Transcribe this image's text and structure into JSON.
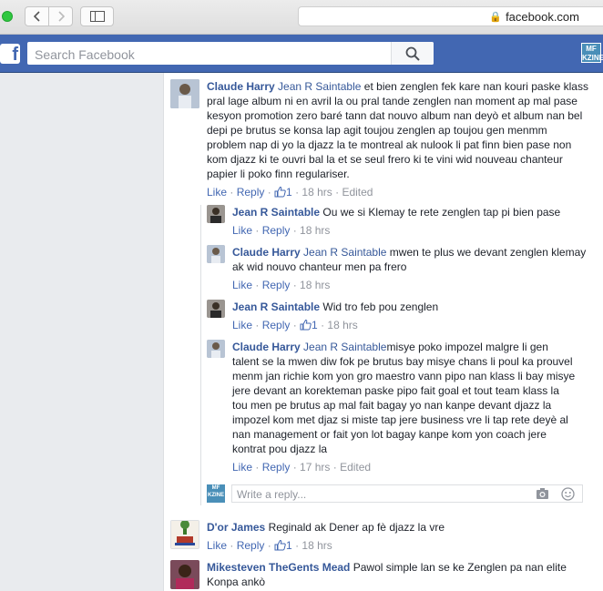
{
  "browser": {
    "url": "facebook.com",
    "icons": {
      "back": "chevron-left-icon",
      "forward": "chevron-right-icon",
      "sidebar": "sidebar-icon",
      "lock": "lock-icon"
    }
  },
  "header": {
    "logo": "f",
    "search_placeholder": "Search Facebook",
    "page_badge": "MF\nKZINE",
    "accent_color": "#4267b2"
  },
  "comments": [
    {
      "author": "Claude Harry",
      "tag": "Jean R Saintable",
      "text": "et bien zenglen fek kare nan kouri paske klass pral lage album ni en avril la ou pral tande zenglen nan moment ap mal pase kesyon promotion zero baré tann dat nouvo album nan deyò et album nan bel depi pe brutus se konsa lap agit toujou zenglen ap toujou gen menmm problem nap di yo la djazz la te montreal ak nulook li pat finn bien pase non kom djazz ki te ouvri bal la et se seul frero ki te vini wid nouveau chanteur papier li poko finn regulariser.",
      "like": "Like",
      "reply": "Reply",
      "likes": "1",
      "time": "18 hrs",
      "edited": "Edited"
    }
  ],
  "replies": [
    {
      "author": "Jean R Saintable",
      "tag": "",
      "text": "Ou we si Klemay te rete zenglen tap pi bien pase",
      "like": "Like",
      "reply": "Reply",
      "likes": "",
      "time": "18 hrs",
      "edited": ""
    },
    {
      "author": "Claude Harry",
      "tag": "Jean R Saintable",
      "text": "mwen te plus we devant zenglen klemay ak wid nouvo chanteur men pa frero",
      "like": "Like",
      "reply": "Reply",
      "likes": "",
      "time": "18 hrs",
      "edited": ""
    },
    {
      "author": "Jean R Saintable",
      "tag": "",
      "text": "Wid tro feb pou zenglen",
      "like": "Like",
      "reply": "Reply",
      "likes": "1",
      "time": "18 hrs",
      "edited": ""
    },
    {
      "author": "Claude Harry",
      "tag": "Jean R Saintable",
      "text": "misye poko impozel malgre li gen talent se la mwen diw fok pe brutus bay misye chans li poul ka prouvel menm jan richie kom yon gro maestro vann pipo nan klass li bay misye jere devant an korekteman paske pipo fait goal et tout team klass la tou men pe brutus ap mal fait bagay yo nan kanpe devant djazz la impozel kom met djaz si miste tap jere business vre li tap rete deyè al nan management or fait yon lot bagay kanpe kom yon coach jere kontrat pou djazz la",
      "like": "Like",
      "reply": "Reply",
      "likes": "",
      "time": "17 hrs",
      "edited": "Edited"
    }
  ],
  "reply_box": {
    "placeholder": "Write a reply...",
    "avatar_badge": "MF\nKZINE"
  },
  "more_comments": [
    {
      "author": "D'or James",
      "text": "Reginald ak Dener ap fè djazz la vre",
      "like": "Like",
      "reply": "Reply",
      "likes": "1",
      "time": "18 hrs"
    },
    {
      "author": "Mikesteven TheGents Mead",
      "text": "Pawol simple lan se ke Zenglen pa nan elite Konpa ankò"
    }
  ]
}
